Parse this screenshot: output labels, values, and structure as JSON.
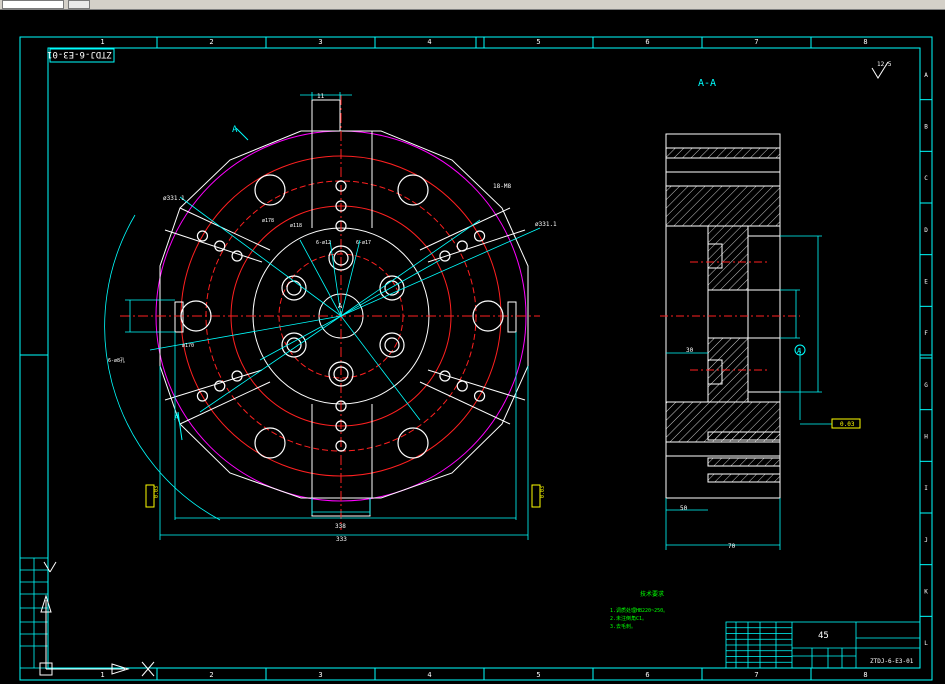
{
  "drawing": {
    "drawing_number": "ZTDJ-6-E3-01",
    "section_label": "A-A",
    "roughness": "12.5",
    "material": "45",
    "grid_cols": [
      "1",
      "2",
      "3",
      "4",
      "5",
      "6",
      "7",
      "8"
    ],
    "grid_rows": [
      "A",
      "B",
      "C",
      "D",
      "E",
      "F",
      "G",
      "H",
      "I",
      "J",
      "K",
      "L"
    ],
    "dims": {
      "dia_outer": "ø331.1",
      "dia_outer2": "ø331.1",
      "dia_178": "ø178",
      "dia_118": "ø118",
      "dia_170": "ø170",
      "dia_4x": "6-ø12",
      "dia_4y": "6-ø17",
      "holes_left": "6-ø8孔",
      "holes_right": "18-M8",
      "dim_11": "11",
      "dim_338": "338",
      "dim_333": "333",
      "dim_50": "50",
      "dim_70": "70",
      "dim_30": "30",
      "section_A": "A",
      "datum": "A",
      "tol": "0.03"
    },
    "notes": {
      "title": "技术要求",
      "line1": "1.调质处理HB220~250。",
      "line2": "2.未注倒角C1。",
      "line3": "3.去毛刺。"
    }
  },
  "colors": {
    "frame": "#00ffff",
    "red": "#ff2020",
    "white": "#ffffff",
    "green": "#00ff00",
    "magenta": "#ff00ff",
    "yellow": "#ffff00"
  },
  "ucs_icon": "ucs-icon"
}
